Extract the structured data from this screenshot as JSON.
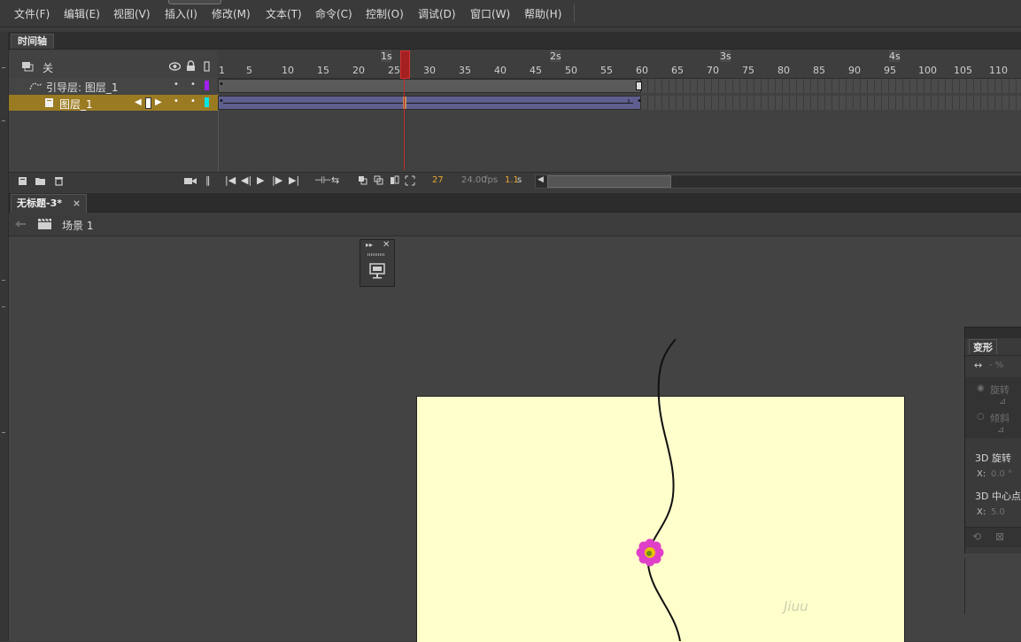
{
  "menubar": {
    "items": [
      "文件(F)",
      "编辑(E)",
      "视图(V)",
      "插入(I)",
      "修改(M)",
      "文本(T)",
      "命令(C)",
      "控制(O)",
      "调试(D)",
      "窗口(W)",
      "帮助(H)"
    ]
  },
  "timeline": {
    "tab_label": "时间轴",
    "header": {
      "label": "关",
      "eye_icon": "eye-icon",
      "lock_icon": "lock-icon",
      "outline_icon": "outline-icon"
    },
    "layers": [
      {
        "name": "引导层: 图层_1",
        "type": "guide",
        "color": "#a020f0"
      },
      {
        "name": "图层_1",
        "type": "normal",
        "color": "#00e5e5",
        "selected": true
      }
    ],
    "ruler": {
      "frame_numbers": [
        "1",
        "5",
        "10",
        "15",
        "20",
        "25",
        "30",
        "35",
        "40",
        "45",
        "50",
        "55",
        "60",
        "65",
        "70",
        "75",
        "80",
        "85",
        "90",
        "95",
        "100",
        "105",
        "110"
      ],
      "seconds": [
        "1s",
        "2s",
        "3s",
        "4s"
      ]
    },
    "current_frame": 27,
    "tween_end_frame": 60,
    "status": {
      "frame": "27",
      "fps": "24.00",
      "fps_unit": "fps",
      "time": "1.1",
      "time_unit": "s"
    }
  },
  "document": {
    "tab_title": "无标题-3*",
    "close_glyph": "×",
    "scene_label": "场景 1"
  },
  "stage": {
    "background_color": "#ffffcc",
    "watermark_text": "Jiuu"
  },
  "transform_panel": {
    "title": "变形",
    "scale_value": "- %",
    "rotate_label": "旋转",
    "skew_label": "倾斜",
    "rotate3d_label": "3D 旋转",
    "x_label": "X:",
    "rotate3d_x": "0.0 °",
    "center3d_label": "3D 中心点",
    "center3d_x": "5.0"
  },
  "colors": {
    "ui_bg": "#3c3c3c",
    "selected_layer": "#9b7b22",
    "playhead": "#c42a2a",
    "tween_span": "#5e5f8f",
    "flower_petal": "#e040c8",
    "flower_center": "#e8c400"
  }
}
